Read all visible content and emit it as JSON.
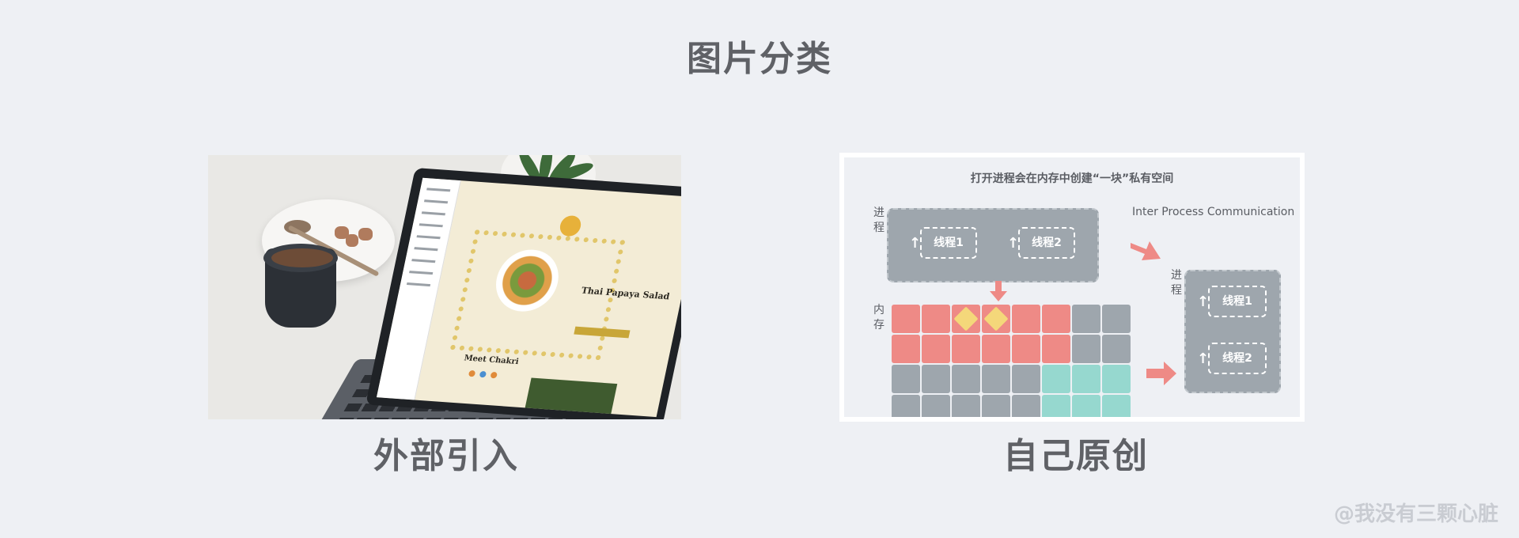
{
  "page": {
    "title": "图片分类",
    "watermark": "@我没有三颗心脏"
  },
  "left_panel": {
    "caption": "外部引入",
    "photo": {
      "heading": "Thai Papaya Salad",
      "subheading": "Meet Chakri"
    }
  },
  "right_panel": {
    "caption": "自己原创",
    "diagram": {
      "title": "打开进程会在内存中创建“一块”私有空间",
      "ipc_label": "Inter Process Communication",
      "process_label": "进程",
      "memory_label": "内存",
      "process_a": {
        "threads": [
          "线程1",
          "线程2"
        ]
      },
      "process_b": {
        "threads": [
          "线程1",
          "线程2"
        ]
      },
      "memory_grid": {
        "rows": 4,
        "cols": 8,
        "cells": [
          [
            "red",
            "red",
            "yellow",
            "yellow",
            "red",
            "red",
            "grey",
            "grey"
          ],
          [
            "red",
            "red",
            "red",
            "red",
            "red",
            "red",
            "grey",
            "grey"
          ],
          [
            "grey",
            "grey",
            "grey",
            "grey",
            "grey",
            "teal",
            "teal",
            "teal"
          ],
          [
            "grey",
            "grey",
            "grey",
            "grey",
            "grey",
            "teal",
            "teal",
            "teal"
          ]
        ]
      },
      "colors": {
        "red": "#ee8a86",
        "grey": "#9ea6ad",
        "teal": "#96d8cf",
        "yellow_bg": "#ee8a86",
        "arrow": "#ee8a86"
      }
    }
  }
}
